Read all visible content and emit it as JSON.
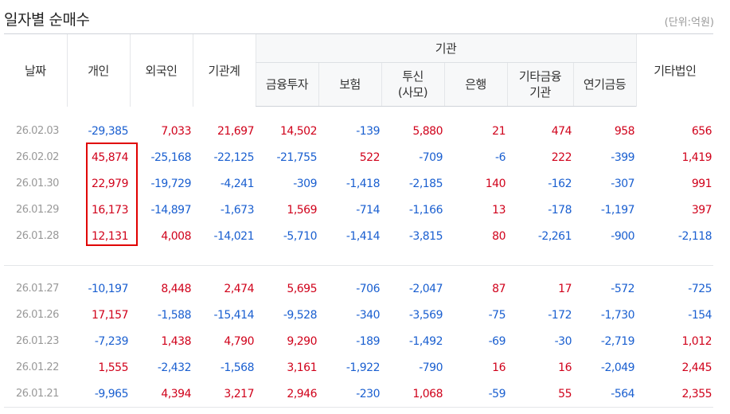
{
  "title": "일자별 순매수",
  "unit": "(단위:억원)",
  "headers": {
    "date": "날짜",
    "individual": "개인",
    "foreign": "외국인",
    "inst_total": "기관계",
    "inst_group": "기관",
    "fin_invest": "금융투자",
    "insurance": "보험",
    "trust_line1": "투신",
    "trust_line2": "(사모)",
    "bank": "은행",
    "other_fin_line1": "기타금융",
    "other_fin_line2": "기관",
    "pension": "연기금등",
    "other_corp": "기타법인"
  },
  "group1": [
    [
      "26.02.03",
      "-29,385",
      "7,033",
      "21,697",
      "14,502",
      "-139",
      "5,880",
      "21",
      "474",
      "958",
      "656"
    ],
    [
      "26.02.02",
      "45,874",
      "-25,168",
      "-22,125",
      "-21,755",
      "522",
      "-709",
      "-6",
      "222",
      "-399",
      "1,419"
    ],
    [
      "26.01.30",
      "22,979",
      "-19,729",
      "-4,241",
      "-309",
      "-1,418",
      "-2,185",
      "140",
      "-162",
      "-307",
      "991"
    ],
    [
      "26.01.29",
      "16,173",
      "-14,897",
      "-1,673",
      "1,569",
      "-714",
      "-1,166",
      "13",
      "-178",
      "-1,197",
      "397"
    ],
    [
      "26.01.28",
      "12,131",
      "4,008",
      "-14,021",
      "-5,710",
      "-1,414",
      "-3,815",
      "80",
      "-2,261",
      "-900",
      "-2,118"
    ]
  ],
  "group2": [
    [
      "26.01.27",
      "-10,197",
      "8,448",
      "2,474",
      "5,695",
      "-706",
      "-2,047",
      "87",
      "17",
      "-572",
      "-725"
    ],
    [
      "26.01.26",
      "17,157",
      "-1,588",
      "-15,414",
      "-9,528",
      "-340",
      "-3,569",
      "-75",
      "-172",
      "-1,730",
      "-154"
    ],
    [
      "26.01.23",
      "-7,239",
      "1,438",
      "4,790",
      "9,290",
      "-189",
      "-1,492",
      "-69",
      "-30",
      "-2,719",
      "1,012"
    ],
    [
      "26.01.22",
      "1,555",
      "-2,432",
      "-1,568",
      "3,161",
      "-1,922",
      "-790",
      "16",
      "16",
      "-2,049",
      "2,445"
    ],
    [
      "26.01.21",
      "-9,965",
      "4,394",
      "3,217",
      "2,946",
      "-230",
      "1,068",
      "-59",
      "55",
      "-564",
      "2,355"
    ]
  ],
  "colors": {
    "positive": "#d0021b",
    "negative": "#1a5fd0",
    "highlight": "#e00000"
  }
}
